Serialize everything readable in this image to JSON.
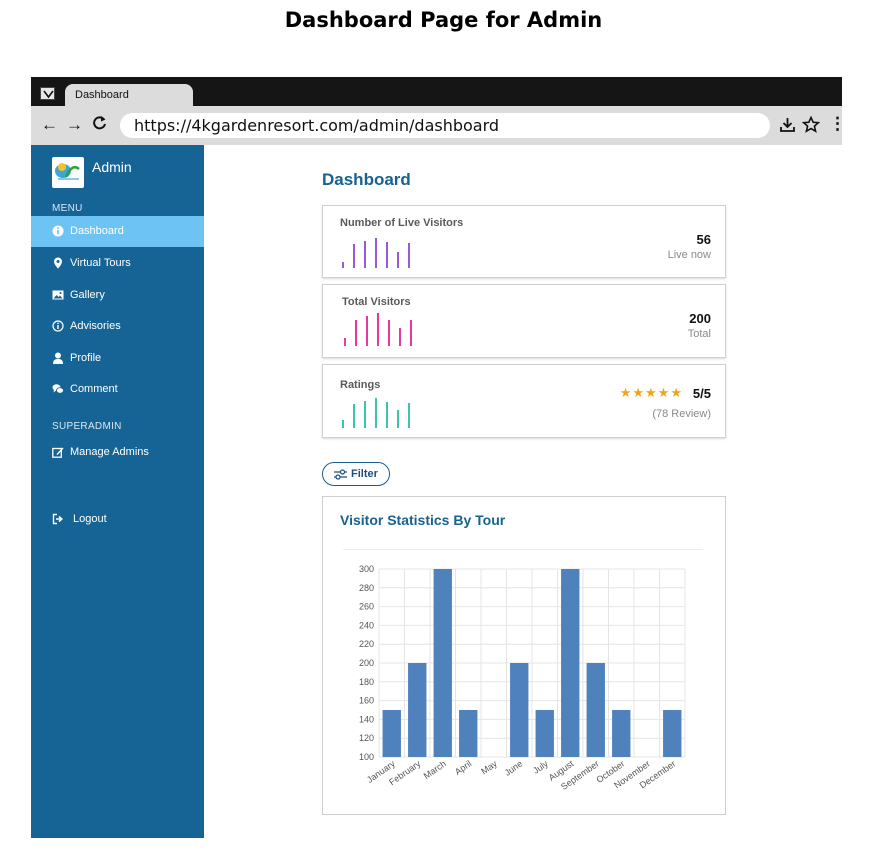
{
  "heading": "Dashboard Page for Admin",
  "browser": {
    "tab_title": "Dashboard",
    "url": "https://4kgardenresort.com/admin/dashboard",
    "back": "←",
    "forward": "→",
    "reload": "C",
    "more": "⋮"
  },
  "sidebar": {
    "admin_name": "Admin",
    "menu_label": "MENU",
    "items": [
      {
        "label": "Dashboard",
        "icon": "info-icon",
        "active": true
      },
      {
        "label": "Virtual Tours",
        "icon": "location-pin-icon"
      },
      {
        "label": "Gallery",
        "icon": "image-icon"
      },
      {
        "label": "Advisories",
        "icon": "info-icon"
      },
      {
        "label": "Profile",
        "icon": "user-icon"
      },
      {
        "label": "Comment",
        "icon": "comments-icon"
      }
    ],
    "superadmin_label": "SUPERADMIN",
    "manage_admins": "Manage Admins",
    "logout": "Logout"
  },
  "main": {
    "title": "Dashboard",
    "cards": {
      "live": {
        "title": "Number of Live Visitors",
        "value": "56",
        "sub": "Live now",
        "color": "#9a5ad6",
        "bars": [
          0.2,
          0.75,
          0.85,
          0.95,
          0.8,
          0.5,
          0.78
        ]
      },
      "total": {
        "title": "Total Visitors",
        "value": "200",
        "sub": "Total",
        "color": "#e8389b",
        "bars": [
          0.25,
          0.8,
          0.9,
          1.0,
          0.8,
          0.55,
          0.8
        ]
      },
      "ratings": {
        "title": "Ratings",
        "stars": "★★★★★",
        "value": "5/5",
        "sub": "(78 Review)",
        "color": "#3bc4b0",
        "bars": [
          0.25,
          0.75,
          0.85,
          0.95,
          0.8,
          0.55,
          0.78
        ]
      }
    },
    "filter_label": "Filter"
  },
  "colors": {
    "sidebar": "#166496",
    "active": "#6ec3f5",
    "accent": "#17628f",
    "bar": "#4f81bd"
  },
  "chart_data": {
    "type": "bar",
    "title": "Visitor Statistics By Tour",
    "categories": [
      "January",
      "February",
      "March",
      "April",
      "May",
      "June",
      "July",
      "August",
      "September",
      "October",
      "November",
      "December"
    ],
    "values": [
      150,
      200,
      300,
      150,
      null,
      200,
      150,
      300,
      200,
      150,
      null,
      150
    ],
    "ylim": [
      100,
      300
    ],
    "yticks": [
      100,
      120,
      140,
      160,
      180,
      200,
      220,
      240,
      260,
      280,
      300
    ],
    "grid": true,
    "xlabel": "",
    "ylabel": ""
  }
}
